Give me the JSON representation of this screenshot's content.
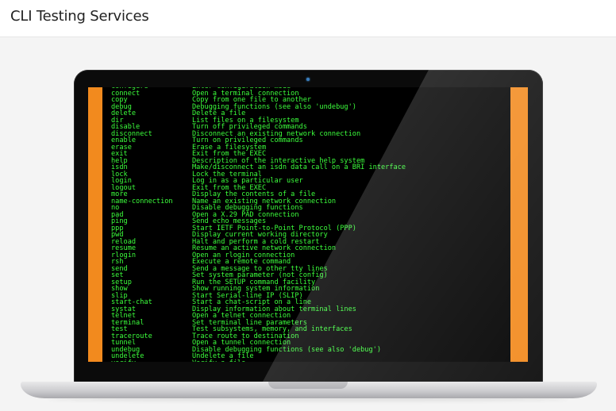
{
  "header": {
    "title": "CLI Testing Services"
  },
  "terminal": {
    "lines": [
      {
        "cmd": "configure",
        "desc": "Enter configuration mode"
      },
      {
        "cmd": "connect",
        "desc": "Open a terminal connection"
      },
      {
        "cmd": "copy",
        "desc": "Copy from one file to another"
      },
      {
        "cmd": "debug",
        "desc": "Debugging functions (see also 'undebug')"
      },
      {
        "cmd": "delete",
        "desc": "Delete a file"
      },
      {
        "cmd": "dir",
        "desc": "List files on a filesystem"
      },
      {
        "cmd": "disable",
        "desc": "Turn off privileged commands"
      },
      {
        "cmd": "disconnect",
        "desc": "Disconnect an existing network connection"
      },
      {
        "cmd": "enable",
        "desc": "Turn on privileged commands"
      },
      {
        "cmd": "erase",
        "desc": "Erase a filesystem"
      },
      {
        "cmd": "exit",
        "desc": "Exit from the EXEC"
      },
      {
        "cmd": "help",
        "desc": "Description of the interactive help system"
      },
      {
        "cmd": "isdn",
        "desc": "Make/disconnect an isdn data call on a BRI interface"
      },
      {
        "cmd": "lock",
        "desc": "Lock the terminal"
      },
      {
        "cmd": "login",
        "desc": "Log in as a particular user"
      },
      {
        "cmd": "logout",
        "desc": "Exit from the EXEC"
      },
      {
        "cmd": "more",
        "desc": "Display the contents of a file"
      },
      {
        "cmd": "name-connection",
        "desc": "Name an existing network connection"
      },
      {
        "cmd": "no",
        "desc": "Disable debugging functions"
      },
      {
        "cmd": "pad",
        "desc": "Open a X.29 PAD connection"
      },
      {
        "cmd": "ping",
        "desc": "Send echo messages"
      },
      {
        "cmd": "ppp",
        "desc": "Start IETF Point-to-Point Protocol (PPP)"
      },
      {
        "cmd": "pwd",
        "desc": "Display current working directory"
      },
      {
        "cmd": "reload",
        "desc": "Halt and perform a cold restart"
      },
      {
        "cmd": "resume",
        "desc": "Resume an active network connection"
      },
      {
        "cmd": "rlogin",
        "desc": "Open an rlogin connection"
      },
      {
        "cmd": "rsh",
        "desc": "Execute a remote command"
      },
      {
        "cmd": "send",
        "desc": "Send a message to other tty lines"
      },
      {
        "cmd": "set",
        "desc": "Set system parameter (not config)"
      },
      {
        "cmd": "setup",
        "desc": "Run the SETUP command facility"
      },
      {
        "cmd": "show",
        "desc": "Show running system information"
      },
      {
        "cmd": "slip",
        "desc": "Start Serial-line IP (SLIP)"
      },
      {
        "cmd": "start-chat",
        "desc": "Start a chat-script on a line"
      },
      {
        "cmd": "systat",
        "desc": "Display information about terminal lines"
      },
      {
        "cmd": "telnet",
        "desc": "Open a telnet connection"
      },
      {
        "cmd": "terminal",
        "desc": "Set terminal line parameters"
      },
      {
        "cmd": "test",
        "desc": "Test subsystems, memory, and interfaces"
      },
      {
        "cmd": "traceroute",
        "desc": "Trace route to destination"
      },
      {
        "cmd": "tunnel",
        "desc": "Open a tunnel connection"
      },
      {
        "cmd": "undebug",
        "desc": "Disable debugging functions (see also 'debug')"
      },
      {
        "cmd": "undelete",
        "desc": "Undelete a file"
      },
      {
        "cmd": "verify",
        "desc": "Verify a file"
      }
    ]
  },
  "colors": {
    "accent_orange": "#f28a1e",
    "terminal_text": "#3cff3c",
    "terminal_bg": "#000000"
  }
}
